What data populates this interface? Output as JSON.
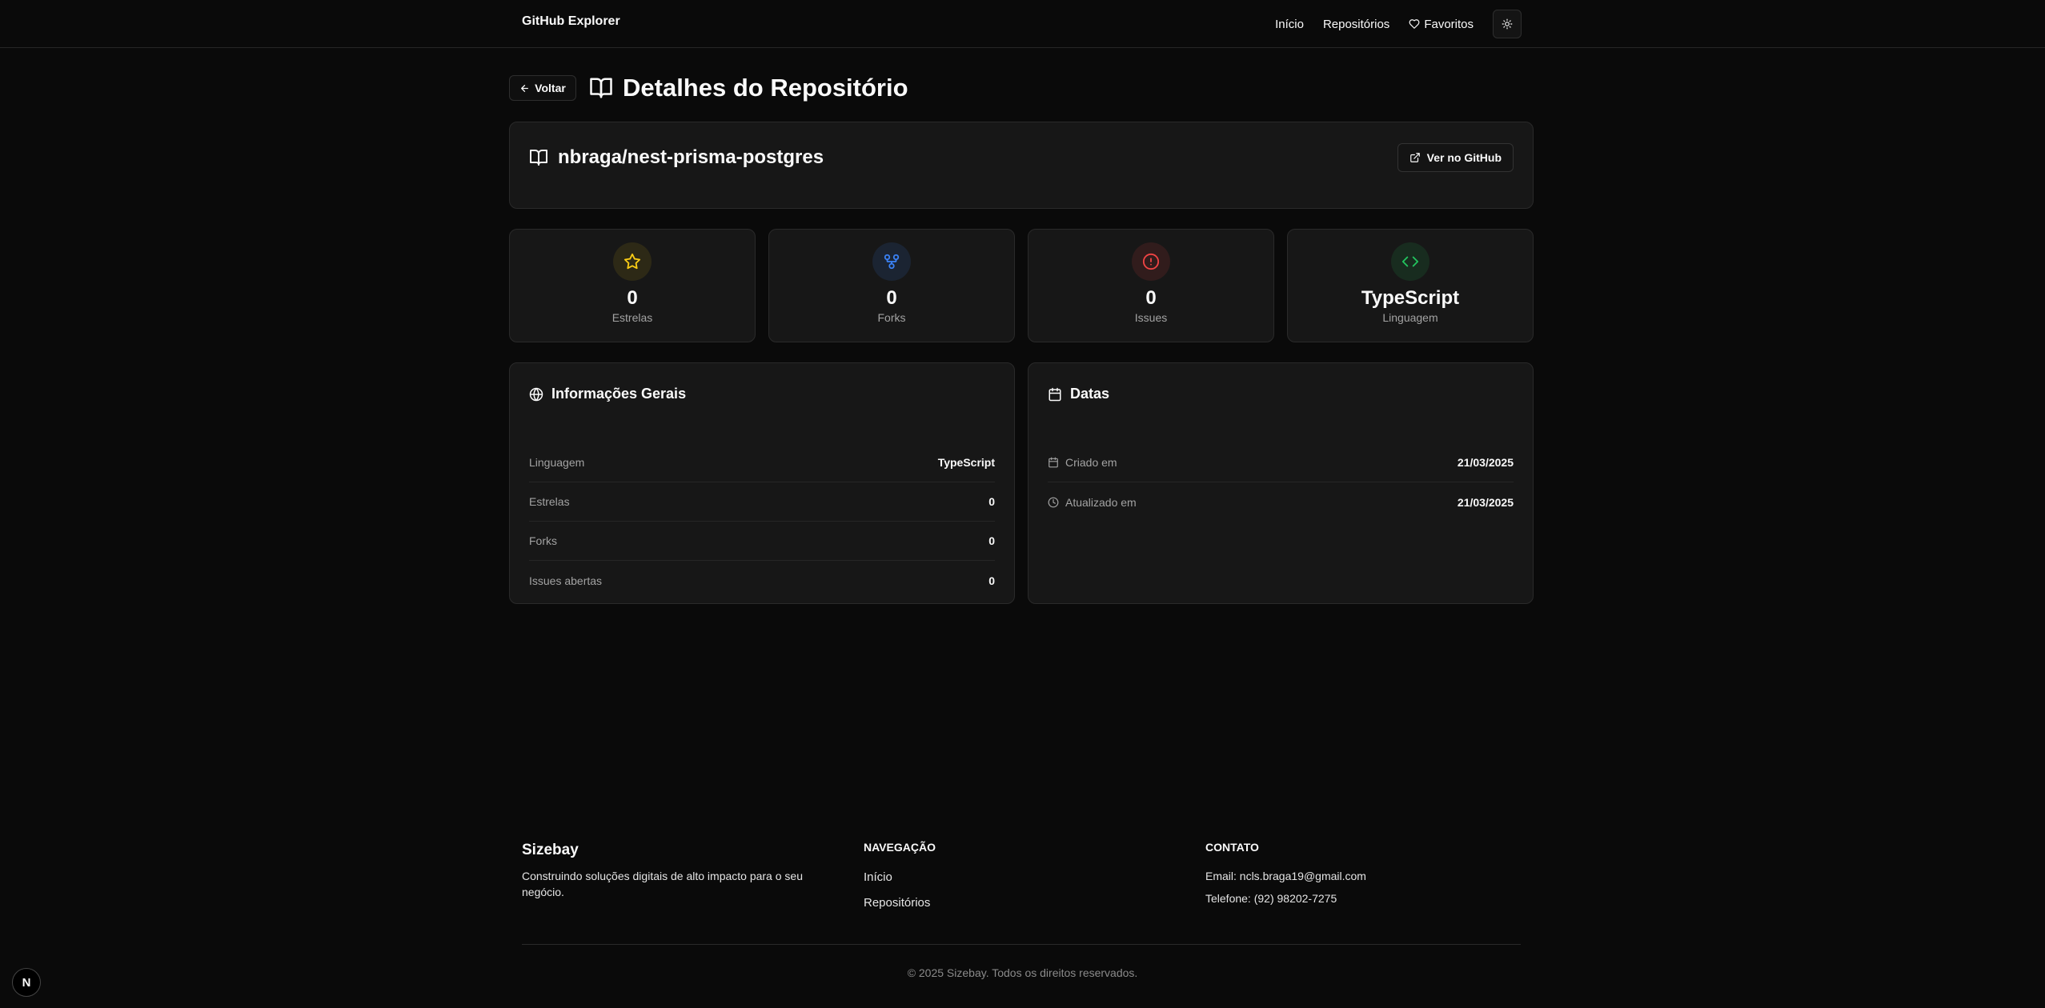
{
  "header": {
    "brand": "GitHub Explorer",
    "nav": {
      "home": "Início",
      "repos": "Repositórios",
      "favorites": "Favoritos"
    },
    "theme_icon": "sun-icon"
  },
  "page": {
    "back_label": "Voltar",
    "title": "Detalhes do Repositório",
    "title_icon": "book-open-icon"
  },
  "repo": {
    "full_name": "nbraga/nest-prisma-postgres",
    "github_button": "Ver no GitHub"
  },
  "stats": [
    {
      "value": "0",
      "label": "Estrelas",
      "icon": "star-icon",
      "color": "#facc15"
    },
    {
      "value": "0",
      "label": "Forks",
      "icon": "git-fork-icon",
      "color": "#3b82f6"
    },
    {
      "value": "0",
      "label": "Issues",
      "icon": "alert-circle-icon",
      "color": "#ef4444"
    },
    {
      "value": "TypeScript",
      "label": "Linguagem",
      "icon": "code-icon",
      "color": "#22c55e"
    }
  ],
  "general_info": {
    "title": "Informações Gerais",
    "rows": [
      {
        "label": "Linguagem",
        "value": "TypeScript"
      },
      {
        "label": "Estrelas",
        "value": "0"
      },
      {
        "label": "Forks",
        "value": "0"
      },
      {
        "label": "Issues abertas",
        "value": "0"
      }
    ]
  },
  "dates": {
    "title": "Datas",
    "rows": [
      {
        "label": "Criado em",
        "value": "21/03/2025",
        "icon": "calendar-icon"
      },
      {
        "label": "Atualizado em",
        "value": "21/03/2025",
        "icon": "clock-icon"
      }
    ]
  },
  "footer": {
    "brand": "Sizebay",
    "description": "Construindo soluções digitais de alto impacto para o seu negócio.",
    "nav_heading": "NAVEGAÇÃO",
    "nav_links": [
      "Início",
      "Repositórios"
    ],
    "contact_heading": "CONTATO",
    "email": "Email: ncls.braga19@gmail.com",
    "phone": "Telefone: (92) 98202-7275",
    "copyright": "© 2025 Sizebay. Todos os direitos reservados."
  },
  "dev_badge": "N"
}
